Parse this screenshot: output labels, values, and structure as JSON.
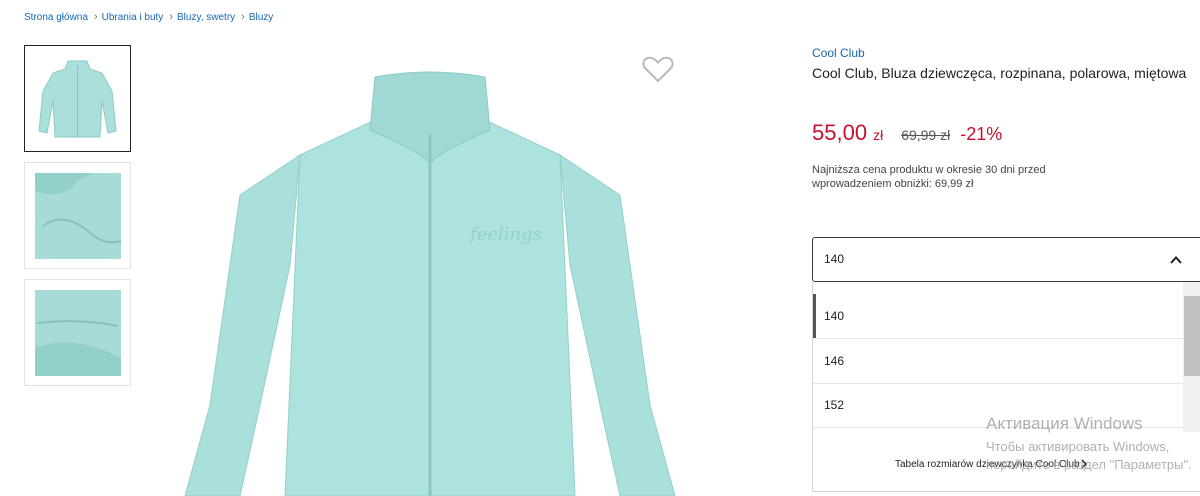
{
  "breadcrumb": [
    "Strona główna",
    "Ubrania i buty",
    "Bluzy, swetry",
    "Bluzy"
  ],
  "product": {
    "brand": "Cool Club",
    "title": "Cool Club, Bluza dziewczęca, rozpinana, polarowa, miętowa",
    "price_value": "55,00",
    "price_currency": "zł",
    "old_price": "69,99 zł",
    "discount": "-21%",
    "lowest_price_note": "Najniższa cena produktu w okresie 30 dni przed wprowadzeniem obniżki: 69,99 zł"
  },
  "size_select": {
    "value": "140",
    "options": [
      "140",
      "146",
      "152"
    ],
    "size_table_label": "Tabela rozmiarów dziewczynka Cool Club"
  },
  "gallery": {
    "thumbnails": 3,
    "selected": 0,
    "product_color": "#a9e0dc"
  },
  "colors": {
    "link": "#1767b3",
    "price": "#c8102e"
  },
  "icons": {
    "favorite": "heart-outline-icon",
    "dropdown": "chevron-up-icon",
    "size_table": "chevron-right-icon"
  },
  "watermark": {
    "title": "Активация Windows",
    "line1": "Чтобы активировать Windows,",
    "line2": "перейдите в раздел \"Параметры\"."
  }
}
